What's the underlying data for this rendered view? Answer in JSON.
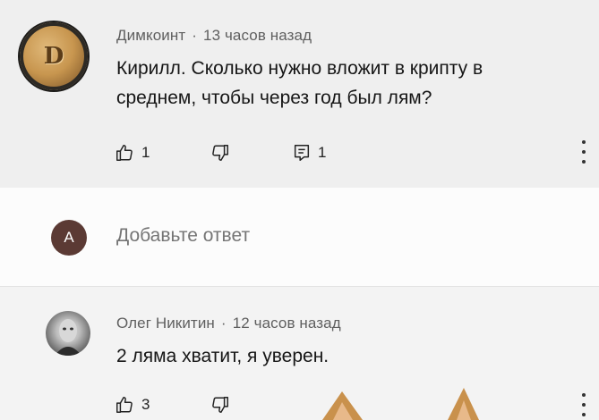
{
  "comments": [
    {
      "author": "Димкоинт",
      "time": "13 часов назад",
      "text_line1": "Кирилл. Сколько нужно вложит в крипту в",
      "text_line2": "среднем, чтобы через год был лям?",
      "likes": "1",
      "replies": "1",
      "avatar_icon": "dogecoin-icon",
      "avatar_letter": "D"
    },
    {
      "author": "Олег Никитин",
      "time": "12 часов назад",
      "text": "2 ляма хватит, я уверен.",
      "likes": "3",
      "avatar_icon": "user-photo"
    }
  ],
  "reply": {
    "avatar_letter": "A",
    "placeholder": "Добавьте ответ"
  },
  "separator": "·",
  "colors": {
    "background": "#efefef",
    "reply_background": "#fcfcfc",
    "reply_avatar": "#5b3a34",
    "meta_text": "#5f5f5f"
  }
}
